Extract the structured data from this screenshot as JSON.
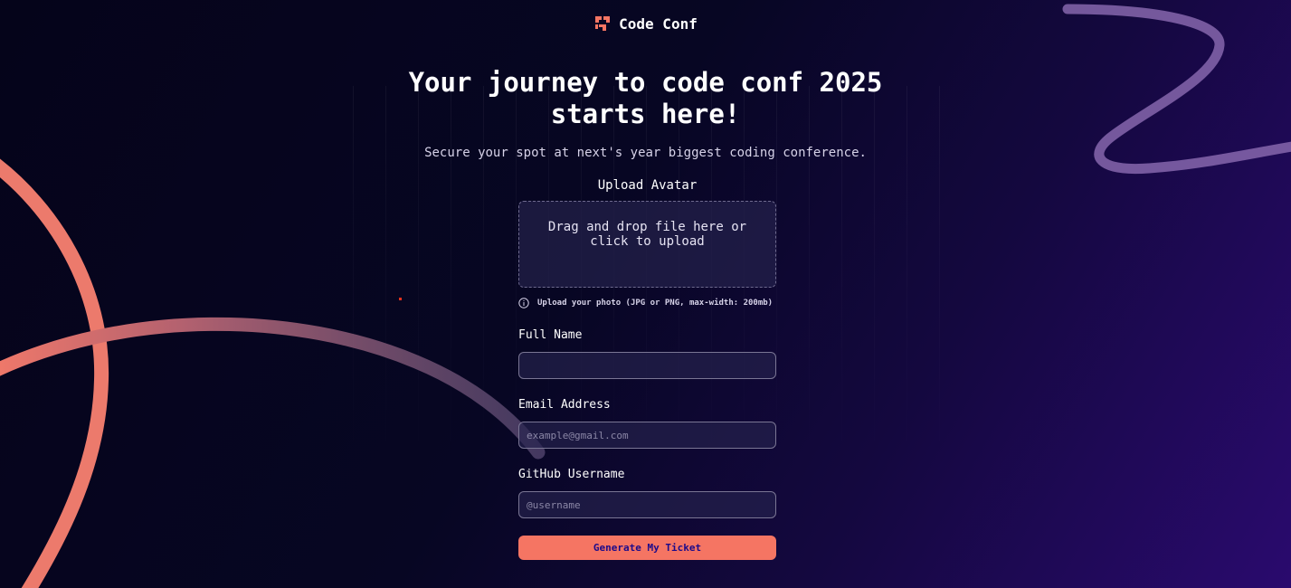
{
  "brand": {
    "name": "Code Conf",
    "icon": "code-conf-logo-icon",
    "accent_color": "#f57563"
  },
  "hero": {
    "title_line1": "Your journey to code conf 2025",
    "title_line2": "starts here!",
    "subtitle": "Secure your spot at next's year biggest coding conference."
  },
  "form": {
    "avatar": {
      "label": "Upload Avatar",
      "dropzone_text": "Drag and drop file here or click to upload",
      "hint_icon": "info-icon",
      "hint": "Upload your photo (JPG or PNG, max-width: 200mb)"
    },
    "full_name": {
      "label": "Full Name",
      "value": "",
      "placeholder": ""
    },
    "email": {
      "label": "Email Address",
      "value": "",
      "placeholder": "example@gmail.com"
    },
    "github": {
      "label": "GitHub Username",
      "value": "",
      "placeholder": "@username"
    },
    "submit_label": "Generate My Ticket"
  },
  "colors": {
    "button_bg": "#f57563",
    "button_text": "#1c0a8a",
    "coral_curve": "#f1796a",
    "lavender_curve": "#8a6db0"
  }
}
